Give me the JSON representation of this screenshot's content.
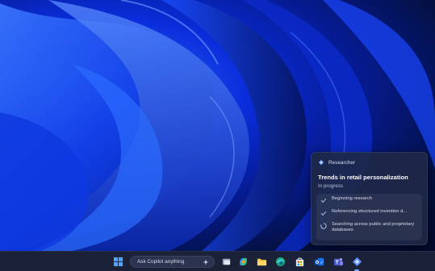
{
  "researcher_popup": {
    "app_name": "Researcher",
    "title": "Trends in retail personalization",
    "status": "In progress",
    "steps": [
      {
        "label": "Beginning research",
        "state": "done"
      },
      {
        "label": "Referencing structured invention d...",
        "state": "done"
      },
      {
        "label": "Searching across public and proprietary databases",
        "state": "in-progress"
      }
    ]
  },
  "taskbar": {
    "search_placeholder": "Ask Copilot anything",
    "apps": [
      "start-icon",
      "task-view-icon",
      "copilot-app-icon",
      "file-explorer-icon",
      "edge-icon",
      "store-icon",
      "outlook-icon",
      "teams-icon",
      "researcher-icon"
    ]
  },
  "colors": {
    "wallpaper_primary": "#0a2ddb",
    "popup_bg": "#1e2846",
    "taskbar_bg": "#1b2238",
    "accent": "#4f8bff"
  }
}
